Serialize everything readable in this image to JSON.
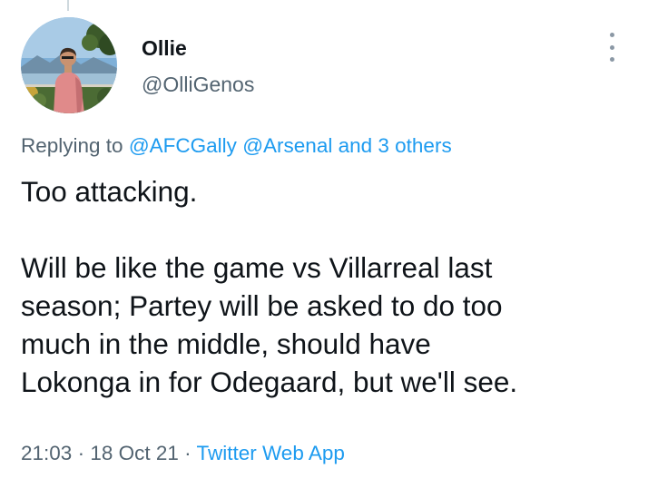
{
  "user": {
    "display_name": "Ollie",
    "handle": "@OlliGenos",
    "avatar_icon": "profile-photo-man-by-lake"
  },
  "reply_context": {
    "prefix": "Replying to ",
    "mentions": [
      "@AFCGally",
      "@Arsenal"
    ],
    "connector": " and ",
    "others": "3 others"
  },
  "tweet": {
    "lines": [
      "Too attacking.",
      "",
      "Will be like the game vs Villarreal last",
      "season; Partey will be asked to do too",
      "much in the middle, should have",
      "Lokonga in for Odegaard, but we'll see."
    ]
  },
  "meta": {
    "time": "21:03",
    "separator": " · ",
    "date": "18 Oct 21",
    "source": "Twitter Web App"
  },
  "colors": {
    "link": "#1d9bf0",
    "secondary_text": "#536471",
    "primary_text": "#0f1419"
  },
  "icons": {
    "more": "more-options-vertical-icon"
  }
}
